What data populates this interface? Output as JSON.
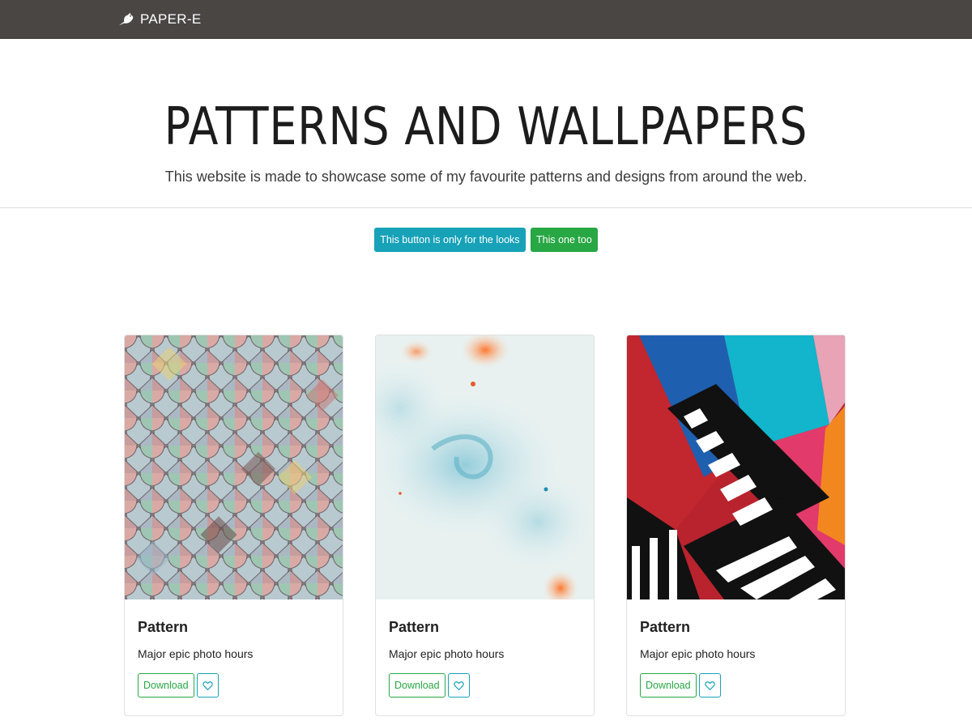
{
  "navbar": {
    "brand": "PAPER-E",
    "logo_icon": "bird-icon"
  },
  "hero": {
    "title": "PATTERNS AND WALLPAPERS",
    "subtitle": "This website is made to showcase some of my favourite patterns and designs from around the web."
  },
  "buttons": {
    "primary": "This button is only for the looks",
    "secondary": "This one too"
  },
  "colors": {
    "navbar": "#4a4644",
    "info": "#17a2b8",
    "success": "#28a745"
  },
  "cards": [
    {
      "title": "Pattern",
      "text": "Major epic photo hours",
      "download": "Download",
      "image": "pastel-scale-tiles"
    },
    {
      "title": "Pattern",
      "text": "Major epic photo hours",
      "download": "Download",
      "image": "watercolor-swirl"
    },
    {
      "title": "Pattern",
      "text": "Major epic photo hours",
      "download": "Download",
      "image": "geometric-stripes"
    }
  ]
}
